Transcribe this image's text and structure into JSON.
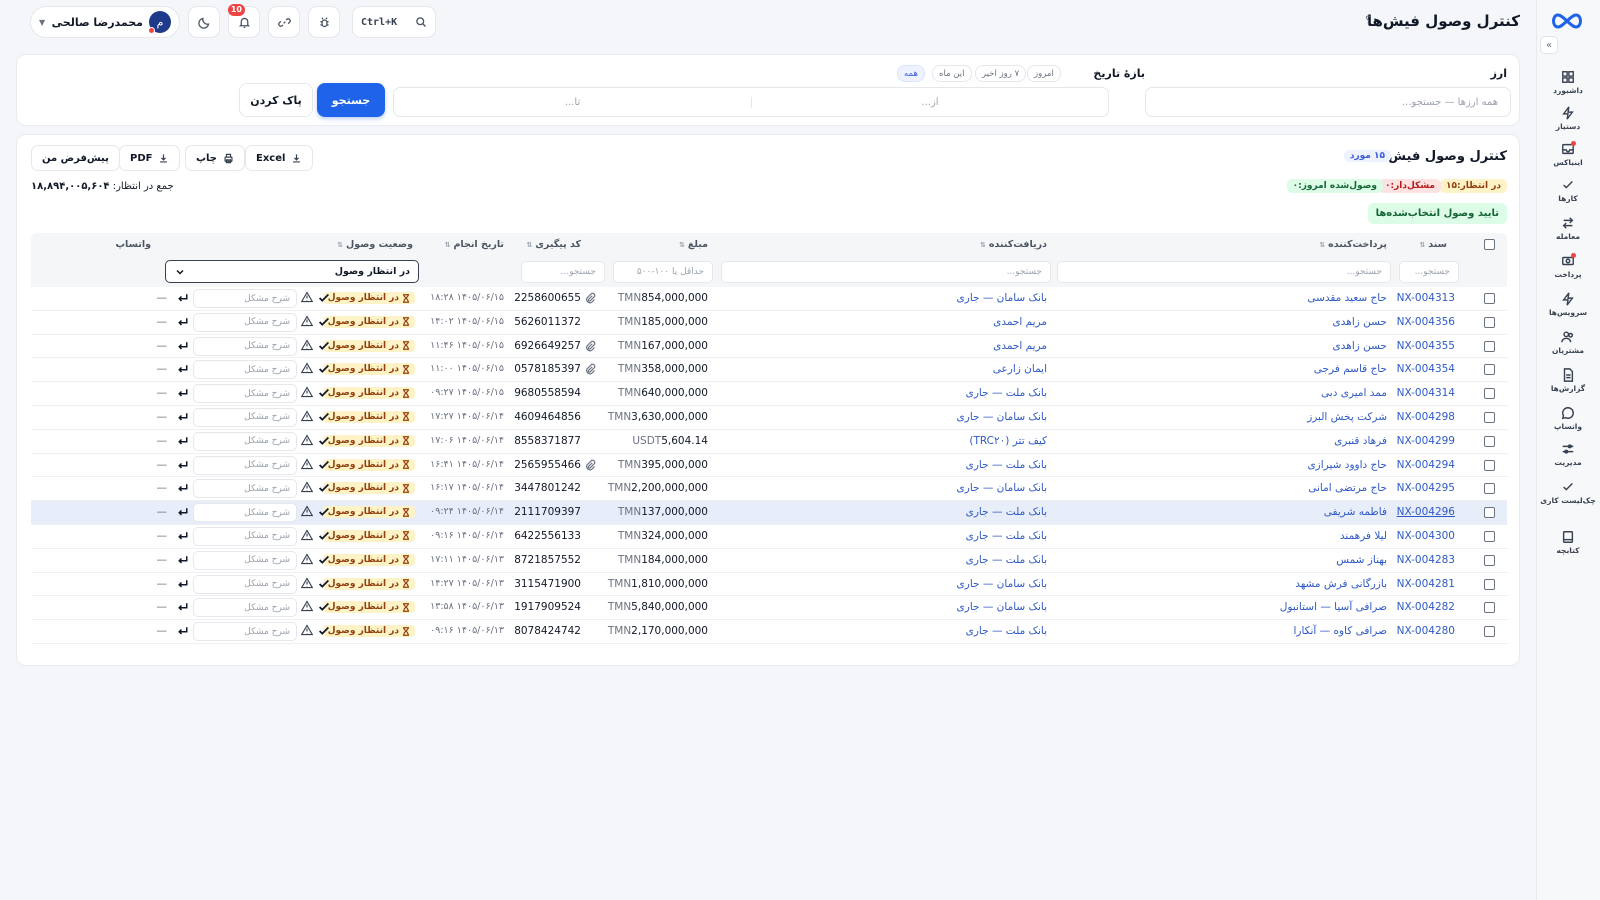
{
  "header": {
    "title": "کنترل وصول فیش‌ها",
    "help": "؟",
    "user_name": "محمدرضا صالحی",
    "user_initial": "م",
    "notif_count": "10",
    "shortcut": "Ctrl+K"
  },
  "sidebar": {
    "items": [
      {
        "label": "داشبورد",
        "icon": "grid-icon"
      },
      {
        "label": "دستیار",
        "icon": "bolt-icon"
      },
      {
        "label": "اینباکس",
        "icon": "inbox-icon"
      },
      {
        "label": "کارها",
        "icon": "check-icon"
      },
      {
        "label": "معامله",
        "icon": "swap-icon"
      },
      {
        "label": "پرداخت",
        "icon": "cash-icon"
      },
      {
        "label": "سرویس‌ها",
        "icon": "bolt-icon"
      },
      {
        "label": "مشتریان",
        "icon": "users-icon"
      },
      {
        "label": "گزارش‌ها",
        "icon": "report-icon"
      },
      {
        "label": "واتساپ",
        "icon": "chat-icon"
      },
      {
        "label": "مدیریت",
        "icon": "sliders-icon"
      },
      {
        "label": "چک‌لیست کاری",
        "icon": "check-icon"
      },
      {
        "label": "کتابچه",
        "icon": "book-icon"
      }
    ]
  },
  "filters": {
    "currency_label": "ارز",
    "currency_placeholder": "همه ارزها — جستجو...",
    "date_label": "بازهٔ تاریخ",
    "date_from_placeholder": "از...",
    "date_to_placeholder": "تا...",
    "range_chips": [
      "همه",
      "این ماه",
      "۷ روز اخیر",
      "امروز"
    ],
    "search_button": "جستجو",
    "clear_button": "پاک کردن"
  },
  "list": {
    "title": "کنترل وصول فیش‌ها",
    "count_badge": "۱۵ مورد",
    "pill_pending": "در انتظار:۱۵",
    "pill_problem": "مشکل‌دار:۰",
    "pill_received": "وصول‌شده امروز:۰",
    "approve_button": "تایید وصول انتخاب‌شده‌ها",
    "sum_label": "جمع در انتظار:",
    "sum_value": "۱۸,۸۹۴,۰۰۵,۶۰۴",
    "toolbar": {
      "excel": "Excel",
      "print": "چاپ",
      "pdf": "PDF",
      "default": "پیش‌فرض من"
    }
  },
  "table": {
    "columns": {
      "doc": "سند",
      "payer": "پرداخت‌کننده",
      "receiver": "دریافت‌کننده",
      "amount": "مبلغ",
      "tracking": "کد پیگیری",
      "date": "تاریخ انجام",
      "status": "وضعیت وصول",
      "whatsapp": "واتساپ"
    },
    "filter_placeholders": {
      "doc": "جستجو...",
      "payer": "جستجو...",
      "receiver": "جستجو...",
      "amount": "حداقل یا ۱۰۰-۵۰۰",
      "tracking": "جستجو..."
    },
    "status_filter_value": "در انتظار وصول",
    "problem_placeholder": "شرح مشکل",
    "status_text": "در انتظار وصول",
    "dash": "—",
    "rows": [
      {
        "doc": "NX-004313",
        "payer": "حاج سعید مقدسی",
        "receiver": "بانک سامان — جاری",
        "amount": "854,000,000",
        "cur": "TMN",
        "tracking": "2258600655",
        "attach": true,
        "date": "۱۴۰۵/۰۶/۱۵ ۱۸:۲۸"
      },
      {
        "doc": "NX-004356",
        "payer": "حسن زاهدی",
        "receiver": "مریم احمدی",
        "amount": "185,000,000",
        "cur": "TMN",
        "tracking": "5626011372",
        "attach": false,
        "date": "۱۴۰۵/۰۶/۱۵ ۱۴:۰۲"
      },
      {
        "doc": "NX-004355",
        "payer": "حسن زاهدی",
        "receiver": "مریم احمدی",
        "amount": "167,000,000",
        "cur": "TMN",
        "tracking": "6926649257",
        "attach": true,
        "date": "۱۴۰۵/۰۶/۱۵ ۱۱:۴۶"
      },
      {
        "doc": "NX-004354",
        "payer": "حاج قاسم فرجی",
        "receiver": "ایمان زارعی",
        "amount": "358,000,000",
        "cur": "TMN",
        "tracking": "0578185397",
        "attach": true,
        "date": "۱۴۰۵/۰۶/۱۵ ۱۱:۰۰"
      },
      {
        "doc": "NX-004314",
        "payer": "ممد امیری دبی",
        "receiver": "بانک ملت — جاری",
        "amount": "640,000,000",
        "cur": "TMN",
        "tracking": "9680558594",
        "attach": false,
        "date": "۱۴۰۵/۰۶/۱۵ ۰۹:۲۷"
      },
      {
        "doc": "NX-004298",
        "payer": "شرکت پخش البرز",
        "receiver": "بانک سامان — جاری",
        "amount": "3,630,000,000",
        "cur": "TMN",
        "tracking": "4609464856",
        "attach": false,
        "date": "۱۴۰۵/۰۶/۱۴ ۱۷:۲۷"
      },
      {
        "doc": "NX-004299",
        "payer": "فرهاد قنبری",
        "receiver": "کیف تتر (TRC۲۰)",
        "amount": "5,604.14",
        "cur": "USDT",
        "tracking": "8558371877",
        "attach": false,
        "date": "۱۴۰۵/۰۶/۱۴ ۱۷:۰۶"
      },
      {
        "doc": "NX-004294",
        "payer": "حاج داوود شیرازی",
        "receiver": "بانک ملت — جاری",
        "amount": "395,000,000",
        "cur": "TMN",
        "tracking": "2565955466",
        "attach": true,
        "date": "۱۴۰۵/۰۶/۱۴ ۱۶:۴۱"
      },
      {
        "doc": "NX-004295",
        "payer": "حاج مرتضی امانی",
        "receiver": "بانک سامان — جاری",
        "amount": "2,200,000,000",
        "cur": "TMN",
        "tracking": "3447801242",
        "attach": false,
        "date": "۱۴۰۵/۰۶/۱۴ ۱۶:۱۷"
      },
      {
        "doc": "NX-004296",
        "payer": "فاطمه شریفی",
        "receiver": "بانک ملت — جاری",
        "amount": "137,000,000",
        "cur": "TMN",
        "tracking": "2111709397",
        "attach": false,
        "date": "۱۴۰۵/۰۶/۱۴ ۰۹:۲۴",
        "selected": true
      },
      {
        "doc": "NX-004300",
        "payer": "لیلا فرهمند",
        "receiver": "بانک ملت — جاری",
        "amount": "324,000,000",
        "cur": "TMN",
        "tracking": "6422556133",
        "attach": false,
        "date": "۱۴۰۵/۰۶/۱۴ ۰۹:۱۶"
      },
      {
        "doc": "NX-004283",
        "payer": "بهناز شمس",
        "receiver": "بانک ملت — جاری",
        "amount": "184,000,000",
        "cur": "TMN",
        "tracking": "8721857552",
        "attach": false,
        "date": "۱۴۰۵/۰۶/۱۳ ۱۷:۱۱"
      },
      {
        "doc": "NX-004281",
        "payer": "بازرگانی فرش مشهد",
        "receiver": "بانک سامان — جاری",
        "amount": "1,810,000,000",
        "cur": "TMN",
        "tracking": "3115471900",
        "attach": false,
        "date": "۱۴۰۵/۰۶/۱۳ ۱۴:۲۷"
      },
      {
        "doc": "NX-004282",
        "payer": "صرافی آسیا — استانبول",
        "receiver": "بانک سامان — جاری",
        "amount": "5,840,000,000",
        "cur": "TMN",
        "tracking": "1917909524",
        "attach": false,
        "date": "۱۴۰۵/۰۶/۱۳ ۱۳:۵۸"
      },
      {
        "doc": "NX-004280",
        "payer": "صرافی کاوه — آنکارا",
        "receiver": "بانک ملت — جاری",
        "amount": "2,170,000,000",
        "cur": "TMN",
        "tracking": "8078424742",
        "attach": false,
        "date": "۱۴۰۵/۰۶/۱۳ ۰۹:۱۶"
      }
    ]
  }
}
